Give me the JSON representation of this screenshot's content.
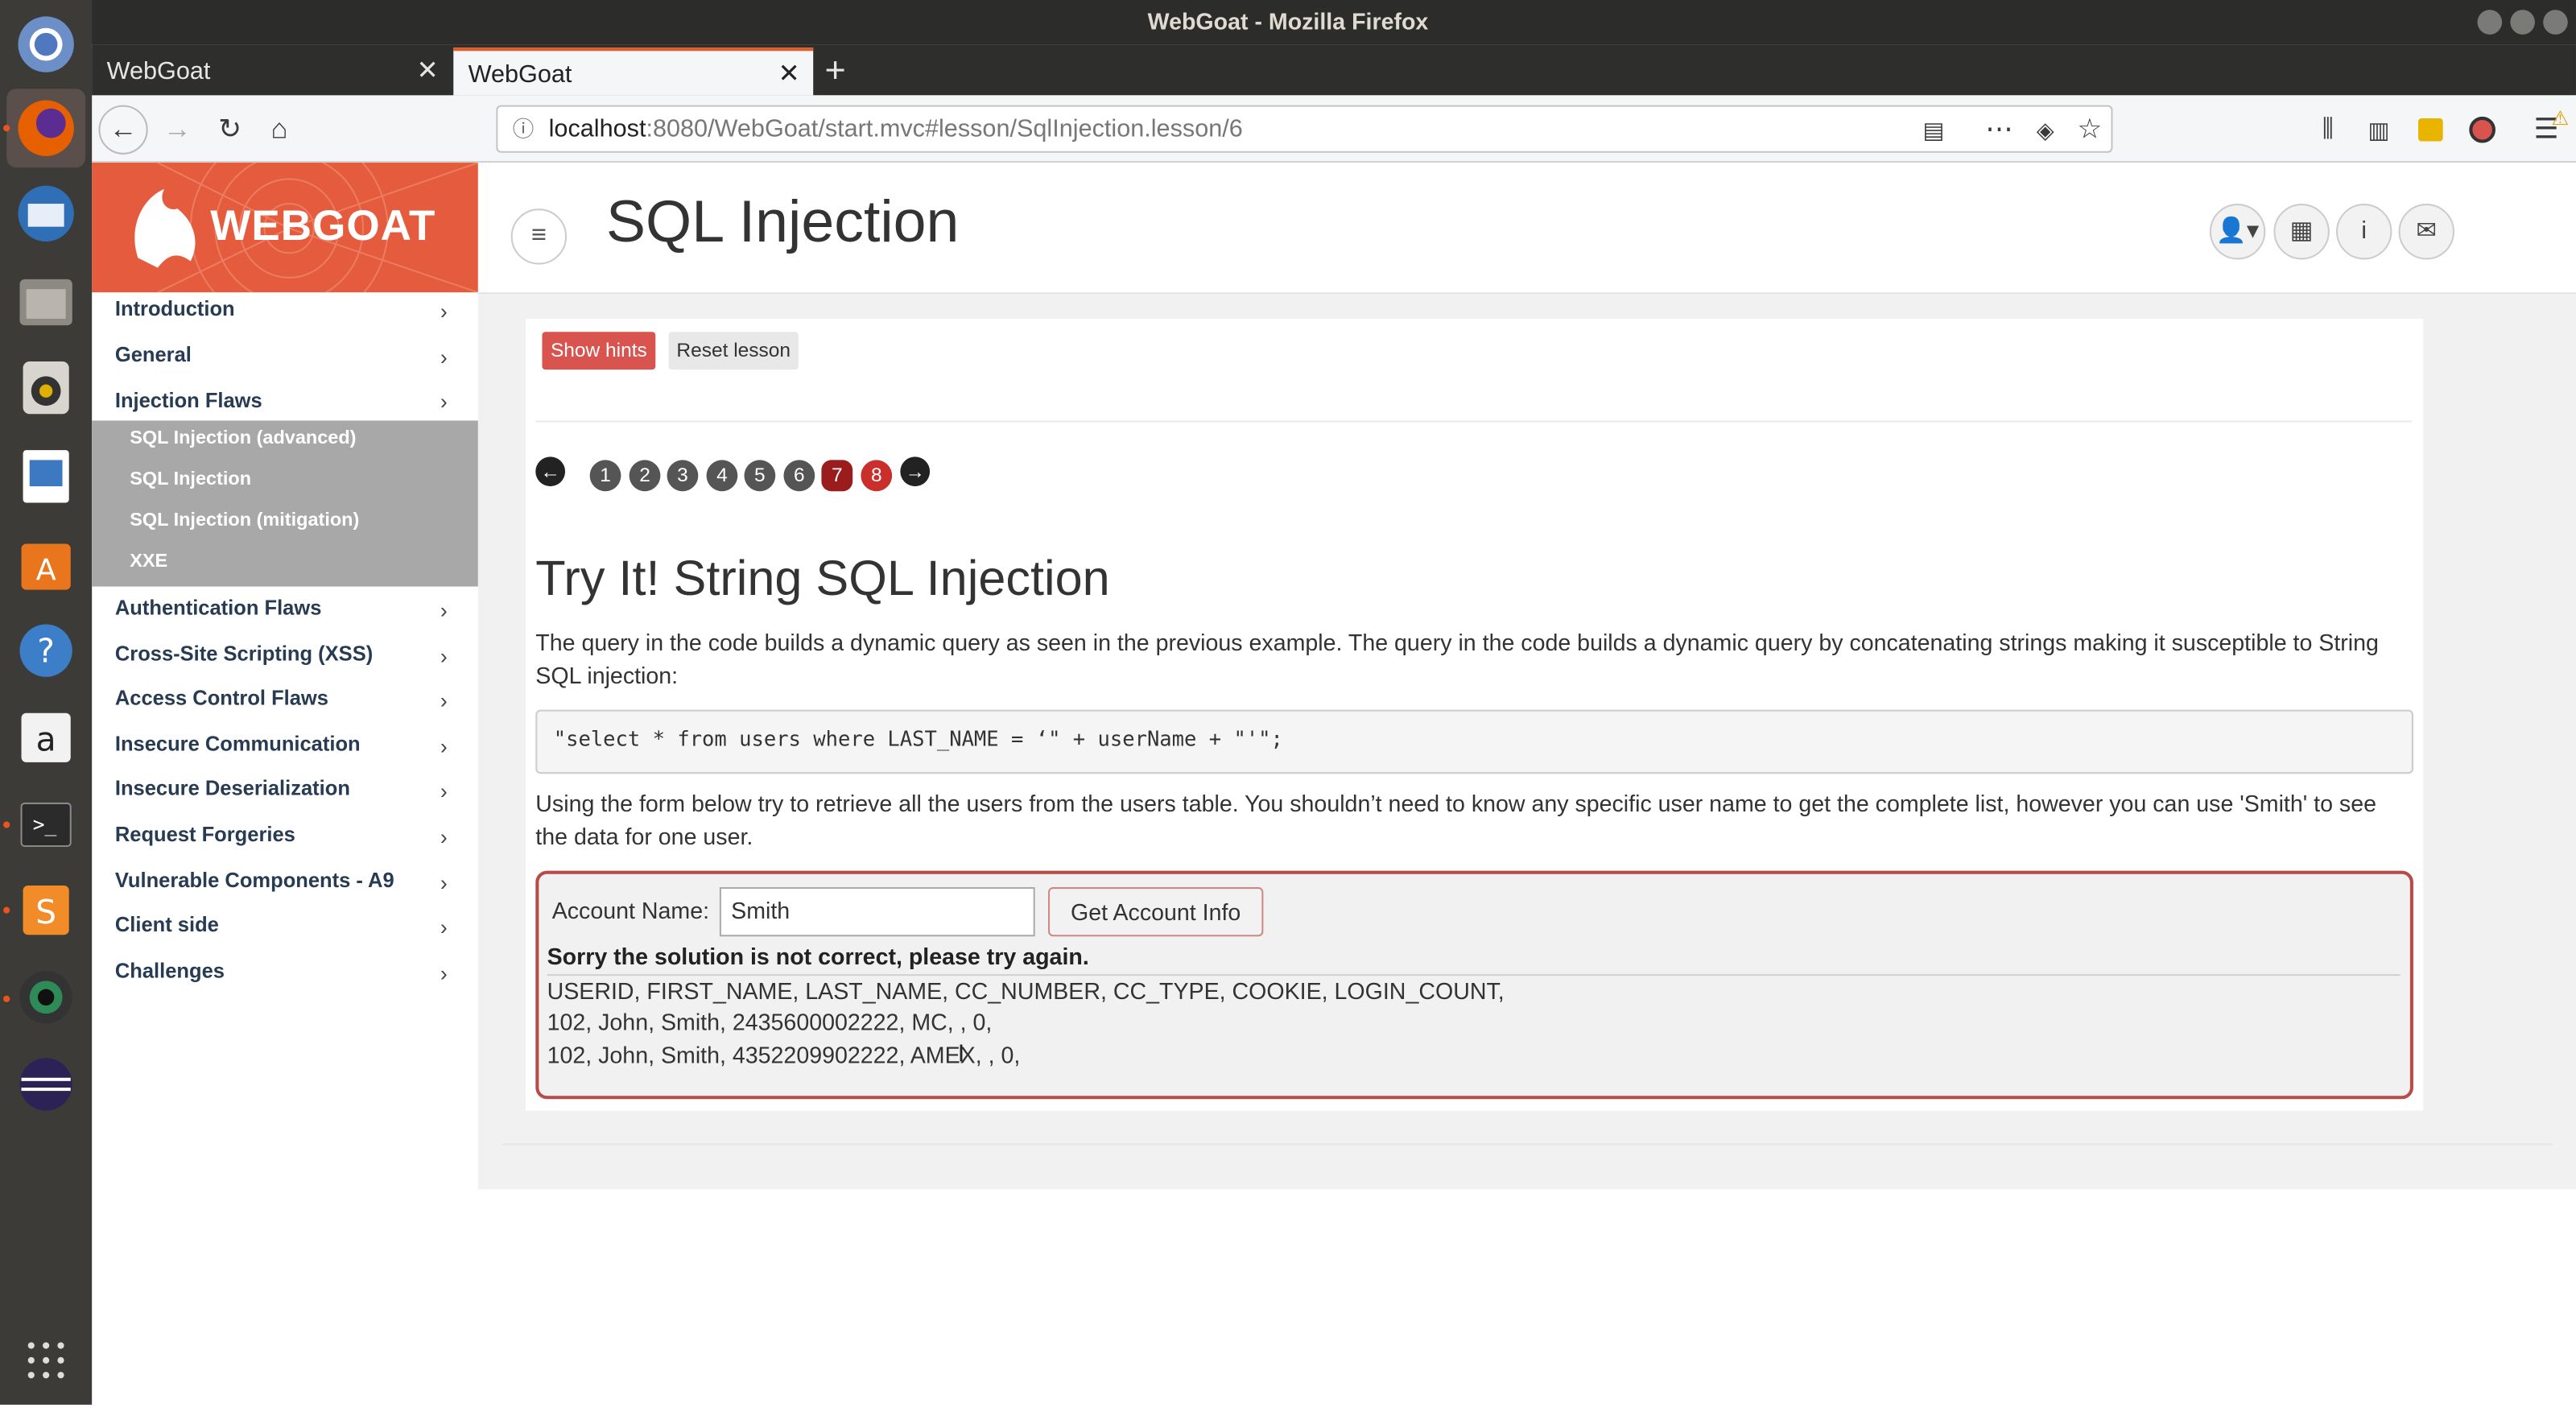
{
  "window": {
    "title": "WebGoat - Mozilla Firefox"
  },
  "tabs": [
    {
      "label": "WebGoat"
    },
    {
      "label": "WebGoat"
    }
  ],
  "address_bar": {
    "host": "localhost",
    "path": ":8080/WebGoat/start.mvc#lesson/SqlInjection.lesson/6"
  },
  "brand": {
    "name": "WEBGOAT"
  },
  "page": {
    "title": "SQL Injection"
  },
  "sidebar": {
    "items": [
      {
        "label": "Introduction"
      },
      {
        "label": "General"
      },
      {
        "label": "Injection Flaws"
      },
      {
        "label": "Authentication Flaws"
      },
      {
        "label": "Cross-Site Scripting (XSS)"
      },
      {
        "label": "Access Control Flaws"
      },
      {
        "label": "Insecure Communication"
      },
      {
        "label": "Insecure Deserialization"
      },
      {
        "label": "Request Forgeries"
      },
      {
        "label": "Vulnerable Components - A9"
      },
      {
        "label": "Client side"
      },
      {
        "label": "Challenges"
      }
    ],
    "submenu": [
      {
        "label": "SQL Injection (advanced)"
      },
      {
        "label": "SQL Injection"
      },
      {
        "label": "SQL Injection (mitigation)"
      },
      {
        "label": "XXE"
      }
    ]
  },
  "lesson": {
    "show_hints": "Show hints",
    "reset_lesson": "Reset lesson",
    "pages": [
      "1",
      "2",
      "3",
      "4",
      "5",
      "6",
      "7",
      "8"
    ],
    "current_page": "7",
    "heading": "Try It! String SQL Injection",
    "intro": "The query in the code builds a dynamic query as seen in the previous example. The query in the code builds a dynamic query by concatenating strings making it susceptible to String SQL injection:",
    "code": "\"select * from users where LAST_NAME = ‘\" + userName + \"'\";",
    "instructions": "Using the form below try to retrieve all the users from the users table. You shouldn’t need to know any specific user name to get the complete list, however you can use 'Smith' to see the data for one user.",
    "form": {
      "label": "Account Name:",
      "value": "Smith",
      "submit": "Get Account Info"
    },
    "feedback": "Sorry the solution is not correct, please try again.",
    "output": [
      "USERID, FIRST_NAME, LAST_NAME, CC_NUMBER, CC_TYPE, COOKIE, LOGIN_COUNT,",
      "102, John, Smith, 2435600002222, MC, , 0,",
      "102, John, Smith, 4352209902222, AMEX, , 0,"
    ]
  }
}
